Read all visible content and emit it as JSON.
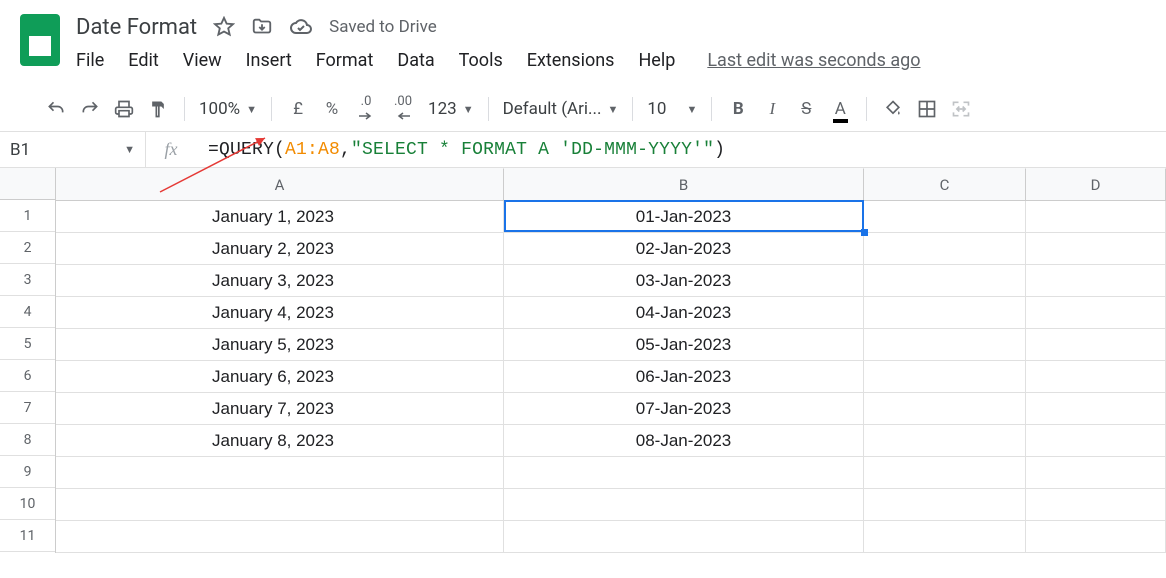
{
  "header": {
    "doc_title": "Date Format",
    "saved_text": "Saved to Drive",
    "menus": [
      "File",
      "Edit",
      "View",
      "Insert",
      "Format",
      "Data",
      "Tools",
      "Extensions",
      "Help"
    ],
    "last_edit": "Last edit was seconds ago"
  },
  "toolbar": {
    "zoom": "100%",
    "currency": "£",
    "percent": "%",
    "dec_dec": ".0",
    "dec_inc": ".00",
    "more_formats": "123",
    "font": "Default (Ari...",
    "font_size": "10",
    "bold": "B",
    "italic": "I",
    "strike": "S",
    "text_color": "A"
  },
  "namebox": {
    "ref": "B1"
  },
  "formula": {
    "prefix": "=QUERY(",
    "range": "A1:A8",
    "sep": ",",
    "query_string": "\"SELECT * FORMAT A 'DD-MMM-YYYY'\"",
    "suffix": ")"
  },
  "columns": [
    "A",
    "B",
    "C",
    "D"
  ],
  "row_nums": [
    "1",
    "2",
    "3",
    "4",
    "5",
    "6",
    "7",
    "8",
    "9",
    "10",
    "11"
  ],
  "data": {
    "A": [
      "January 1, 2023",
      "January 2, 2023",
      "January 3, 2023",
      "January 4, 2023",
      "January 5, 2023",
      "January 6, 2023",
      "January 7, 2023",
      "January 8, 2023",
      "",
      "",
      ""
    ],
    "B": [
      "01-Jan-2023",
      "02-Jan-2023",
      "03-Jan-2023",
      "04-Jan-2023",
      "05-Jan-2023",
      "06-Jan-2023",
      "07-Jan-2023",
      "08-Jan-2023",
      "",
      "",
      ""
    ]
  }
}
